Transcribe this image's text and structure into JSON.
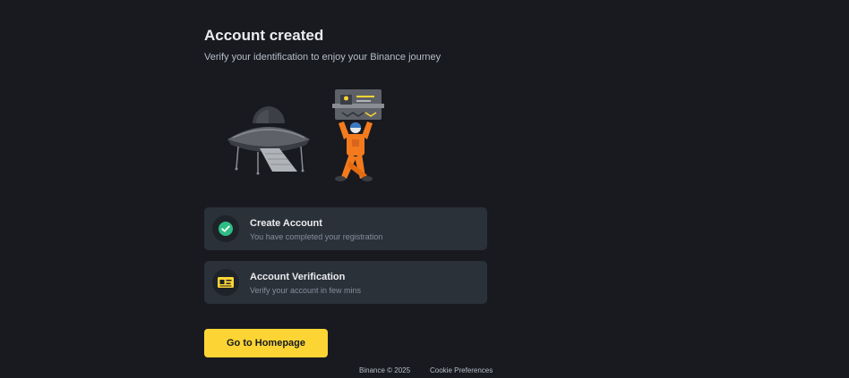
{
  "header": {
    "title": "Account created",
    "subtitle": "Verify your identification to enjoy your Binance journey"
  },
  "steps": [
    {
      "title": "Create Account",
      "description": "You have completed your registration",
      "status": "completed",
      "icon": "check-circle-icon"
    },
    {
      "title": "Account Verification",
      "description": "Verify your account in few mins",
      "status": "pending",
      "icon": "id-card-icon"
    }
  ],
  "actions": {
    "home_label": "Go to Homepage"
  },
  "footer": {
    "copyright": "Binance © 2025",
    "cookie_label": "Cookie Preferences"
  },
  "colors": {
    "background": "#181a20",
    "card": "#2b3139",
    "accent": "#fcd535",
    "success": "#2ebd85",
    "figure": "#f37b1d"
  }
}
